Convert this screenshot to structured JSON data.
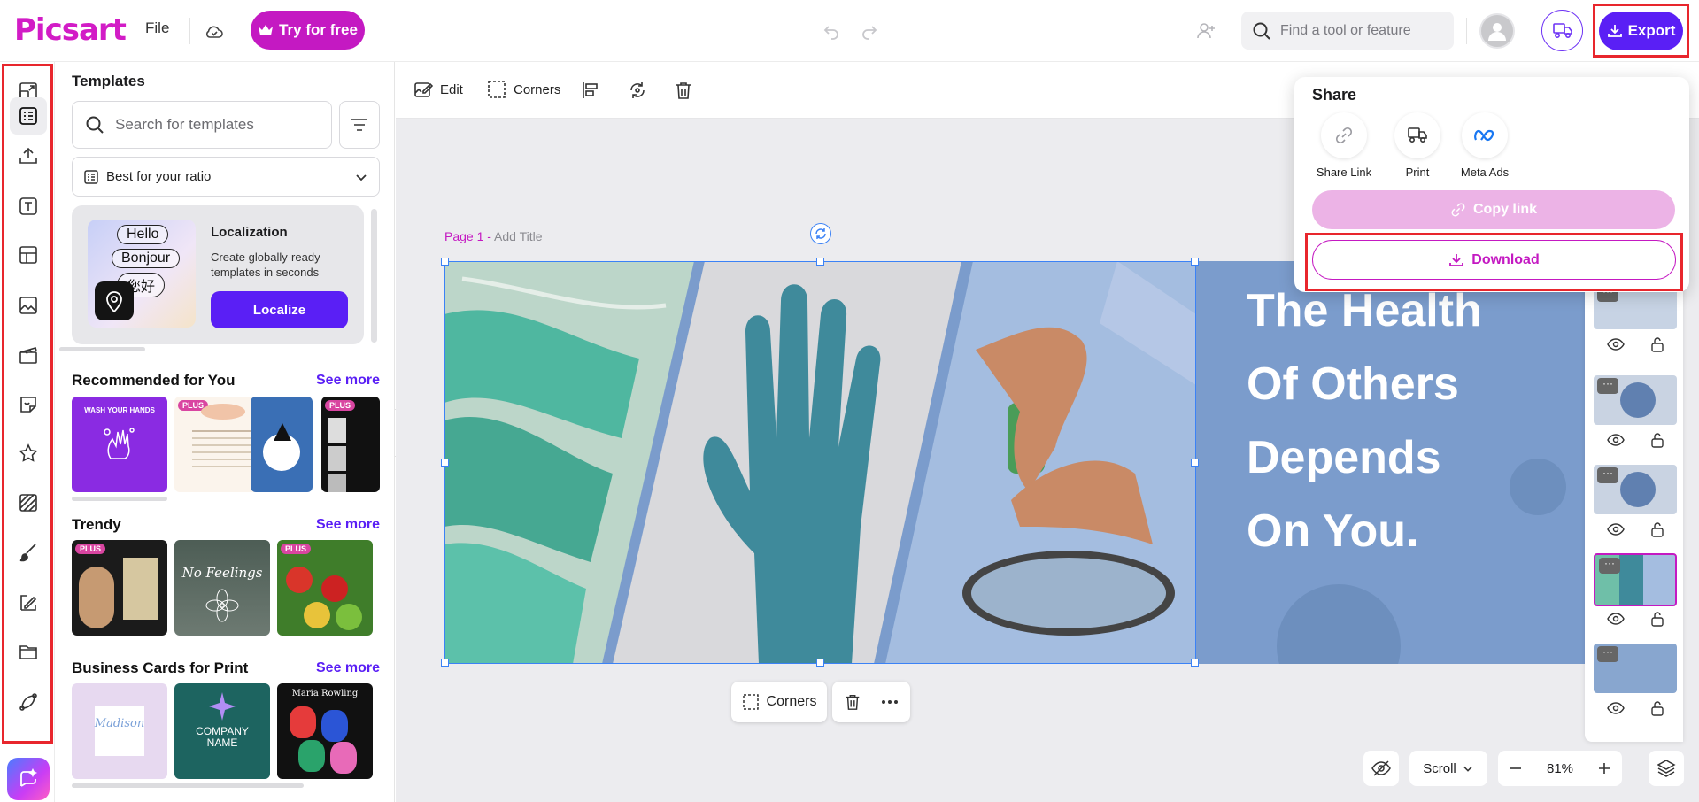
{
  "app": {
    "logo": "Picsart"
  },
  "topbar": {
    "file_label": "File",
    "try_label": "Try for free",
    "search_placeholder": "Find a tool or feature",
    "export_label": "Export"
  },
  "templates": {
    "title": "Templates",
    "search_placeholder": "Search for templates",
    "ratio_label": "Best for your ratio",
    "localization": {
      "title": "Localization",
      "description": "Create globally-ready templates in seconds",
      "button": "Localize",
      "pills": [
        "Hello",
        "Bonjour",
        "您好"
      ]
    },
    "sections": [
      {
        "title": "Recommended for You",
        "see_more": "See more"
      },
      {
        "title": "Trendy",
        "see_more": "See more"
      },
      {
        "title": "Business Cards for Print",
        "see_more": "See more"
      }
    ],
    "thumb_texts": {
      "wash": "WASH YOUR HANDS",
      "plus": "PLUS",
      "no_feelings": "No Feelings",
      "madison": "Madison",
      "company_name": "COMPANY NAME",
      "maria": "Maria Rowling"
    }
  },
  "context_toolbar": {
    "edit": "Edit",
    "corners": "Corners"
  },
  "canvas": {
    "page_label": "Page 1 - ",
    "add_title": "Add Title",
    "headline": [
      "The Health",
      "Of Others",
      "Depends",
      "On You."
    ]
  },
  "floating_toolbar": {
    "corners": "Corners"
  },
  "pages_panel": {
    "dots": "···"
  },
  "bottom_controls": {
    "scroll_label": "Scroll",
    "zoom": "81%"
  },
  "share": {
    "title": "Share",
    "options": [
      "Share Link",
      "Print",
      "Meta Ads"
    ],
    "copy_link": "Copy link",
    "download": "Download"
  },
  "colors": {
    "brand": "#c419c2",
    "accent": "#5a1ff5",
    "highlight": "#e8262d"
  }
}
